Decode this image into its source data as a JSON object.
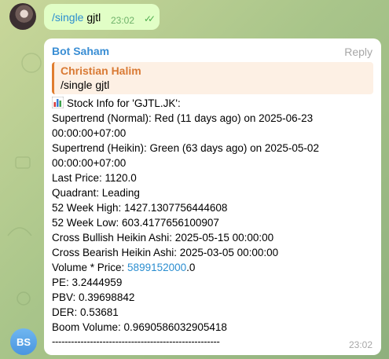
{
  "outgoing": {
    "command": "/single",
    "argument": " gjtl",
    "time": "23:02",
    "status_icon": "double-check-icon"
  },
  "incoming": {
    "sender": "Bot Saham",
    "reply_label": "Reply",
    "quote": {
      "name": "Christian Halim",
      "text": "/single gjtl"
    },
    "lines": [
      "Stock Info for 'GJTL.JK':",
      "Supertrend (Normal): Red (11 days ago) on 2025-06-23",
      "00:00:00+07:00",
      "Supertrend (Heikin): Green (63 days ago) on 2025-05-02",
      "00:00:00+07:00",
      "Last Price: 1120.0",
      "Quadrant: Leading",
      "52 Week High: 1427.1307756444608",
      "52 Week Low: 603.4177656100907",
      "Cross Bullish Heikin Ashi: 2025-05-15 00:00:00",
      "Cross Bearish Heikin Ashi: 2025-03-05 00:00:00"
    ],
    "volume_prefix": "Volume * Price: ",
    "volume_link": "5899152000",
    "volume_suffix": ".0",
    "lines_after": [
      "PE: 3.2444959",
      "PBV: 0.39698842",
      "DER: 0.53681",
      "Boom Volume: 0.9690586032905418"
    ],
    "separator": "-----------------------------------------------------",
    "time": "23:02",
    "bar_icon": "bar-chart-icon"
  },
  "bot_avatar": {
    "initials": "BS",
    "color": "#5aa7ea"
  }
}
